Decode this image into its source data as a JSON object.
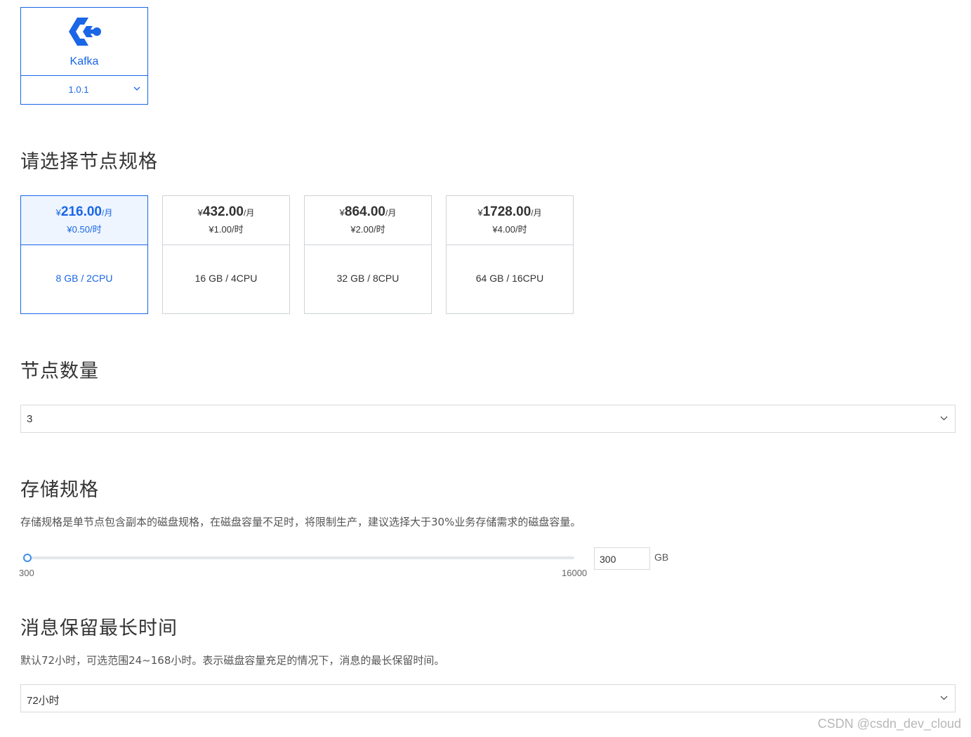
{
  "engine": {
    "name": "Kafka",
    "version": "1.0.1",
    "logo_icon": "kafka-logo-icon",
    "accent": "#1a66e6"
  },
  "node_spec": {
    "title": "请选择节点规格",
    "currency": "¥",
    "per_month": "/月",
    "options": [
      {
        "price": "216.00",
        "hourly": "¥0.50/时",
        "config": "8 GB / 2CPU",
        "selected": true
      },
      {
        "price": "432.00",
        "hourly": "¥1.00/时",
        "config": "16 GB / 4CPU",
        "selected": false
      },
      {
        "price": "864.00",
        "hourly": "¥2.00/时",
        "config": "32 GB / 8CPU",
        "selected": false
      },
      {
        "price": "1728.00",
        "hourly": "¥4.00/时",
        "config": "64 GB / 16CPU",
        "selected": false
      }
    ]
  },
  "node_count": {
    "title": "节点数量",
    "value": "3"
  },
  "storage": {
    "title": "存储规格",
    "description": "存储规格是单节点包含副本的磁盘规格，在磁盘容量不足时，将限制生产，建议选择大于30%业务存储需求的磁盘容量。",
    "min": "300",
    "max": "16000",
    "value": "300",
    "unit": "GB"
  },
  "retention": {
    "title": "消息保留最长时间",
    "description": "默认72小时，可选范围24~168小时。表示磁盘容量充足的情况下，消息的最长保留时间。",
    "value": "72小时"
  },
  "watermark": "CSDN @csdn_dev_cloud"
}
